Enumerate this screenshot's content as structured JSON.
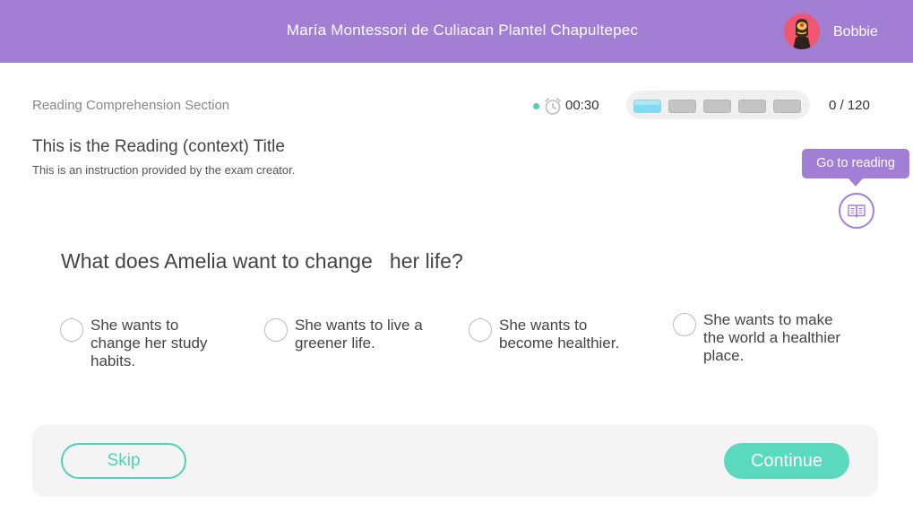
{
  "header": {
    "school_name": "María Montessori de Culiacan Plantel Chapultepec",
    "username": "Bobbie",
    "avatar_icon": "cartoon-avatar-icon"
  },
  "status": {
    "section_label": "Reading Comprehension Section",
    "timer_icon": "alarm-clock-icon",
    "timer": "00:30",
    "progress_segments": 5,
    "progress_active_segments": 1,
    "counter": "0 / 120"
  },
  "reading": {
    "title": "This is the Reading (context) Title",
    "instruction": "This is an instruction provided by the exam creator.",
    "tooltip": "Go to reading",
    "button_icon": "open-book-icon"
  },
  "question": {
    "text": "What does Amelia want to change   her life?",
    "options": [
      {
        "label": "She wants to change her study habits."
      },
      {
        "label": "She wants to live a greener life."
      },
      {
        "label": "She wants to become healthier."
      },
      {
        "label": "She wants to make the world a healthier place."
      }
    ]
  },
  "footer": {
    "skip_label": "Skip",
    "continue_label": "Continue"
  },
  "colors": {
    "header_bg": "#a27fd4",
    "accent_teal": "#5ad9bf",
    "progress_active": "#7fdcf0",
    "avatar_bg": "#f0566d"
  }
}
